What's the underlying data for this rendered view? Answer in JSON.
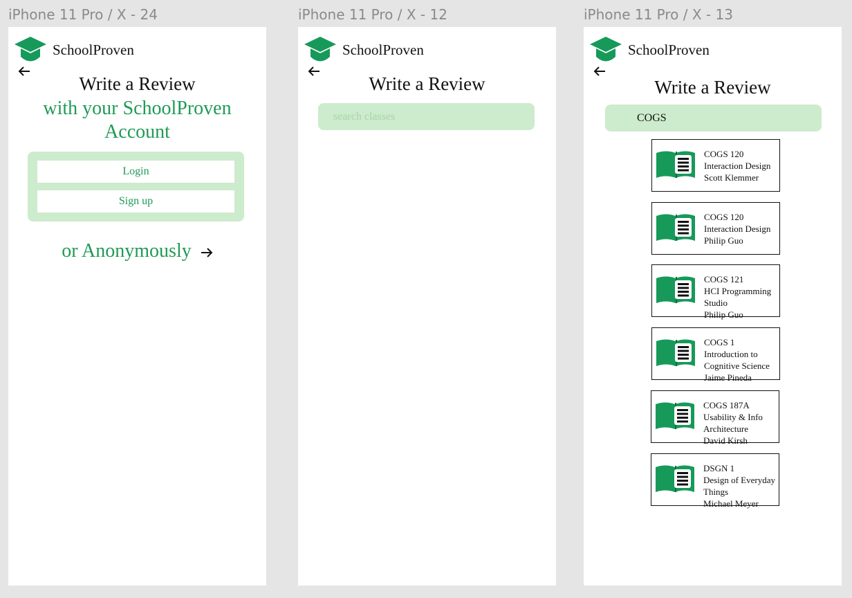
{
  "app_name": "SchoolProven",
  "frames": [
    {
      "label": "iPhone 11 Pro / X - 24"
    },
    {
      "label": "iPhone 11 Pro / X - 12"
    },
    {
      "label": "iPhone 11 Pro / X - 13"
    }
  ],
  "login_screen": {
    "title": "Write a Review",
    "subtitle_line1": "with your SchoolProven",
    "subtitle_line2": "Account",
    "login_label": "Login",
    "signup_label": "Sign up",
    "anonymous_label": "or Anonymously"
  },
  "search_screen": {
    "title": "Write a Review",
    "search_placeholder": "search classes"
  },
  "results_screen": {
    "title": "Write a Review",
    "search_value": "COGS",
    "results": [
      {
        "code": "COGS 120",
        "lines": [
          "Interaction Design"
        ],
        "instructor": "Scott Klemmer"
      },
      {
        "code": "COGS 120",
        "lines": [
          "Interaction Design"
        ],
        "instructor": "Philip Guo"
      },
      {
        "code": "COGS 121",
        "lines": [
          "HCI Programming",
          "Studio"
        ],
        "instructor": "Philip Guo"
      },
      {
        "code": "COGS 1",
        "lines": [
          "Introduction to",
          "Cognitive Science"
        ],
        "instructor": "Jaime Pineda"
      },
      {
        "code": "COGS 187A",
        "lines": [
          "Usability & Info",
          "Architecture"
        ],
        "instructor": "David Kirsh"
      },
      {
        "code": "DSGN 1",
        "lines": [
          "Design of Everyday",
          "Things"
        ],
        "instructor": "Michael Meyer"
      }
    ]
  },
  "colors": {
    "brand_green": "#1f9a56",
    "light_green": "#cdebcd",
    "icon_green": "#17995a"
  },
  "icons": [
    "graduation-cap-icon",
    "arrow-left-icon",
    "arrow-right-icon",
    "book-icon"
  ]
}
